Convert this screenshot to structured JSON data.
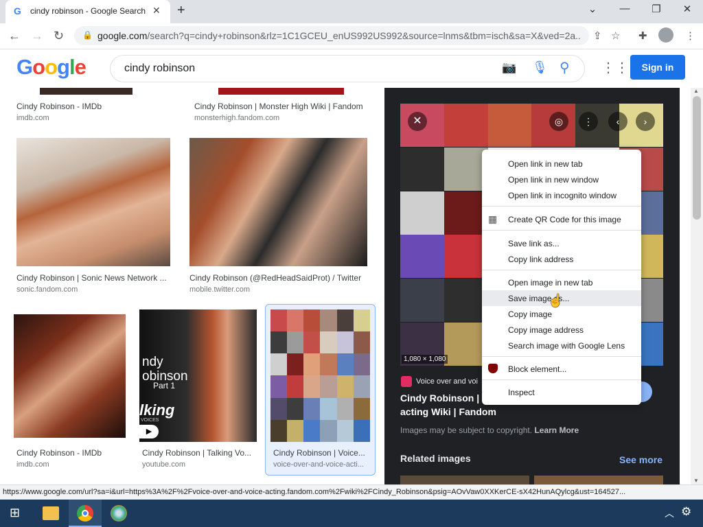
{
  "tab": {
    "title": "cindy robinson - Google Search",
    "favicon": "G"
  },
  "address": {
    "url_host": "google.com",
    "url_rest": "/search?q=cindy+robinson&rlz=1C1GCEU_enUS992US992&source=lnms&tbm=isch&sa=X&ved=2a..."
  },
  "search": {
    "query": "cindy robinson",
    "signin": "Sign in"
  },
  "results": [
    {
      "caption": "Cindy Robinson - IMDb",
      "source": "imdb.com"
    },
    {
      "caption": "Cindy Robinson | Monster High Wiki | Fandom",
      "source": "monsterhigh.fandom.com"
    },
    {
      "caption": "Cindy Robinson | Sonic News Network ...",
      "source": "sonic.fandom.com"
    },
    {
      "caption": "Cindy Robinson (@RedHeadSaidProt) / Twitter",
      "source": "mobile.twitter.com"
    },
    {
      "caption": "Cindy Robinson - IMDb",
      "source": "imdb.com"
    },
    {
      "caption": "Cindy Robinson | Talking Vo...",
      "source": "youtube.com"
    },
    {
      "caption": "Cindy Robinson | Voice...",
      "source": "voice-over-and-voice-acti..."
    }
  ],
  "thumb_texts": {
    "talking_title": "ndy\nobinson",
    "talking_part": "Part 1",
    "talking_brand": "lking",
    "talking_voices": "VOICES"
  },
  "preview": {
    "dims": "1,080 × 1,080",
    "site": "Voice over and voi",
    "title_line1": "Cindy Robinson | V",
    "title_line2": "acting Wiki | Fandom",
    "copyright": "Images may be subject to copyright.",
    "learn_more": "Learn More",
    "related": "Related images",
    "see_more": "See more"
  },
  "context_menu": [
    "Open link in new tab",
    "Open link in new window",
    "Open link in incognito window",
    "Create QR Code for this image",
    "Save link as...",
    "Copy link address",
    "Open image in new tab",
    "Save image as...",
    "Copy image",
    "Copy image address",
    "Search image with Google Lens",
    "Block element...",
    "Inspect"
  ],
  "status_url": "https://www.google.com/url?sa=i&url=https%3A%2F%2Fvoice-over-and-voice-acting.fandom.com%2Fwiki%2FCindy_Robinson&psig=AOvVaw0XXKerCE-sX42HunAQylcg&ust=164527...",
  "colors": {
    "accent": "#1a73e8",
    "dark_panel": "#202124",
    "taskbar": "#1b3a5c"
  }
}
